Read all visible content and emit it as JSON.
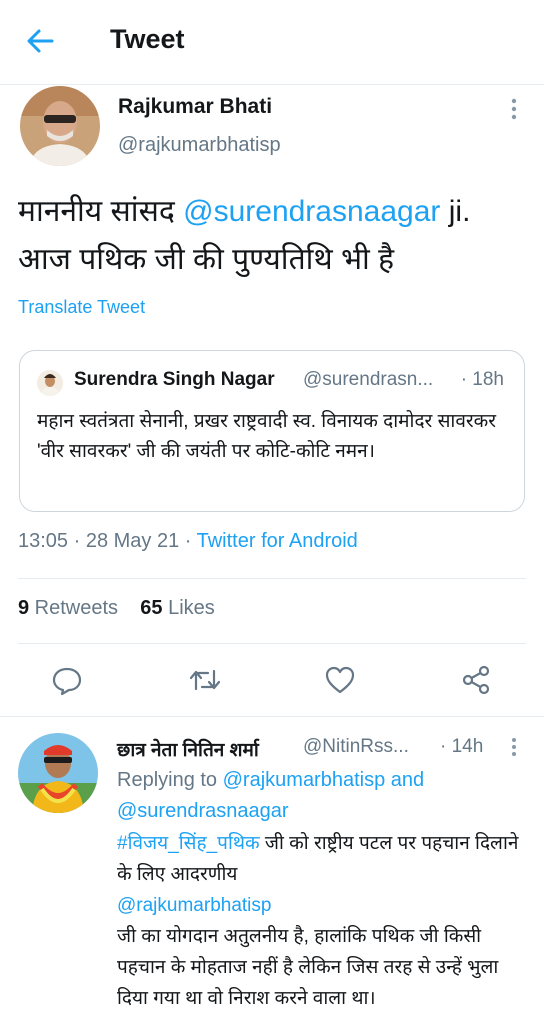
{
  "header": {
    "title": "Tweet",
    "back_icon": "arrow-left-icon"
  },
  "colors": {
    "accent": "#1da1f2",
    "secondary_text": "#657786",
    "primary_text": "#14171a",
    "divider": "#e6ecf0"
  },
  "tweet": {
    "author_name": "Rajkumar Bhati",
    "author_handle": "@rajkumarbhatisp",
    "text_part1": "माननीय सांसद ",
    "text_mention": "@surendrasnaagar",
    "text_part2": " ji. आज पथिक जी की पुण्यतिथि भी है",
    "translate_label": "Translate Tweet",
    "quote": {
      "name": "Surendra Singh Nagar",
      "handle": "@surendrasn...",
      "time": "· 18h",
      "text": "महान स्वतंत्रता सेनानी, प्रखर राष्ट्रवादी स्व. विनायक दामोदर सावरकर 'वीर सावरकर' जी की जयंती पर कोटि-कोटि नमन।"
    },
    "timestamp": "13:05 · 28 May 21 · ",
    "source": "Twitter for Android",
    "retweets_count": "9",
    "retweets_label": " Retweets",
    "likes_count": "65",
    "likes_label": " Likes"
  },
  "actions": [
    "reply-icon",
    "retweet-icon",
    "like-icon",
    "share-icon"
  ],
  "reply": {
    "author_name": "छात्र नेता नितिन शर्मा",
    "author_handle": "@NitinRss...",
    "time": "· 14h",
    "replying_prefix": "Replying to ",
    "replying_user1": "@rajkumarbhatisp",
    "replying_and": " and",
    "replying_user2": "@surendrasnaagar",
    "hashtag": "#विजय_सिंह_पथिक",
    "text1": " जी को राष्ट्रीय पटल पर पहचान दिलाने के लिए आदरणीय",
    "mention": "@rajkumarbhatisp",
    "text2": " जी का योगदान अतुलनीय है, हालांकि पथिक जी किसी पहचान के मोहताज नहीं है लेकिन जिस तरह से उन्हें भुला दिया गया था वो निराश करने वाला था।"
  }
}
